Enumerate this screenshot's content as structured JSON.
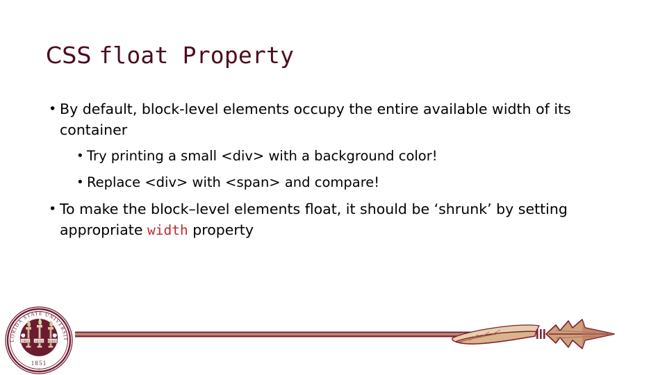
{
  "slide": {
    "title": {
      "part_sans": "CSS ",
      "part_mono_1": "float",
      "part_mono_2": " Property",
      "color": "#4b0d1e"
    },
    "bullets": [
      {
        "level": 1,
        "marker": "•",
        "text": "By default, block-level elements occupy the entire available width of its container"
      },
      {
        "level": 2,
        "marker": "•",
        "text": "Try printing a small <div> with a background color!"
      },
      {
        "level": 2,
        "marker": "•",
        "text": "Replace <div> with <span> and compare!"
      },
      {
        "level": 1,
        "marker": "•",
        "text_before": "To make the block–level elements float, it should be ‘shrunk’ by setting appropriate ",
        "code": "width",
        "text_after": "  property",
        "code_color": "#c1272d"
      }
    ],
    "footer": {
      "logo": {
        "name": "florida-state-university-seal",
        "rim_text_top": "FLORIDA STATE UNIVERSITY",
        "year": "1851",
        "banner_left": "VIRES",
        "banner_center": "ARTES",
        "banner_right": "MORES",
        "seal_color": "#6d1b30",
        "torch_color": "#d9c49a"
      },
      "spear": {
        "name": "fsu-spear",
        "shaft_dark": "#7b2231",
        "shaft_light": "#c08a78",
        "head_fill": "#cfa17c",
        "head_outline": "#7b2231",
        "feather_fill": "#d9b48c"
      }
    }
  }
}
